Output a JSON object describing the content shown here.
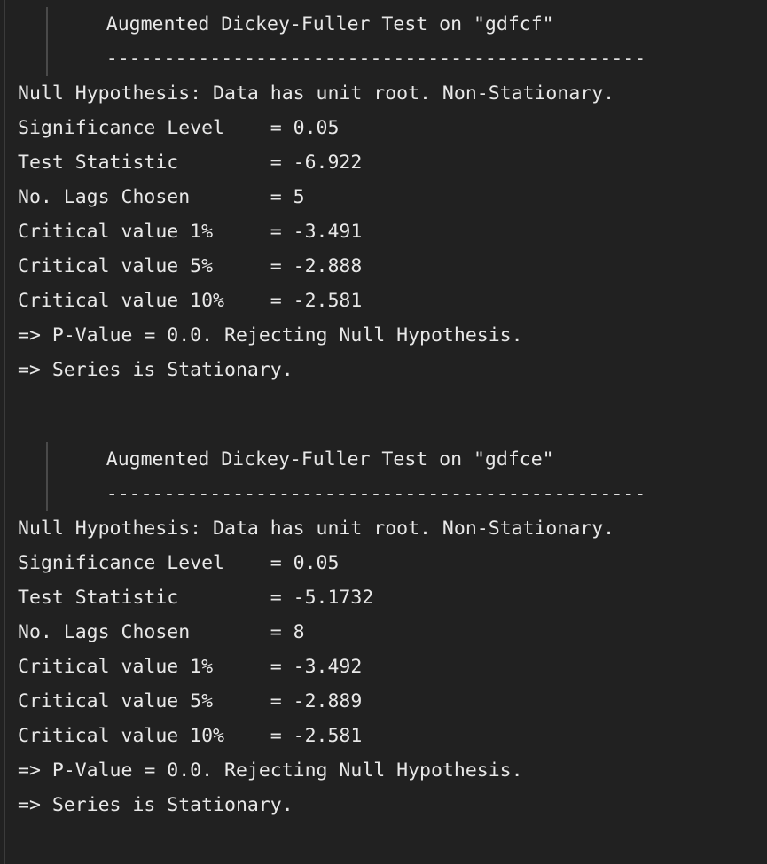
{
  "terminal": {
    "background_color": "#212121",
    "text_color": "#e8e8e8",
    "gutter_color": "#3b3b3b",
    "indent_guide_color": "#4a4a4a"
  },
  "blocks": [
    {
      "title": "    Augmented Dickey-Fuller Test on \"gdfcf\"",
      "divider": "    -----------------------------------------------",
      "null_hypothesis": "Null Hypothesis: Data has unit root. Non-Stationary.",
      "rows": [
        {
          "label": "Significance Level",
          "line": "Significance Level    = 0.05",
          "value": "0.05"
        },
        {
          "label": "Test Statistic",
          "line": "Test Statistic        = -6.922",
          "value": "-6.922"
        },
        {
          "label": "No. Lags Chosen",
          "line": "No. Lags Chosen       = 5",
          "value": "5"
        },
        {
          "label": "Critical value 1%",
          "line": "Critical value 1%     = -3.491",
          "value": "-3.491"
        },
        {
          "label": "Critical value 5%",
          "line": "Critical value 5%     = -2.888",
          "value": "-2.888"
        },
        {
          "label": "Critical value 10%",
          "line": "Critical value 10%    = -2.581",
          "value": "-2.581"
        }
      ],
      "pvalue_line": "=> P-Value = 0.0. Rejecting Null Hypothesis.",
      "conclusion_line": "=> Series is Stationary."
    },
    {
      "title": "    Augmented Dickey-Fuller Test on \"gdfce\"",
      "divider": "    -----------------------------------------------",
      "null_hypothesis": "Null Hypothesis: Data has unit root. Non-Stationary.",
      "rows": [
        {
          "label": "Significance Level",
          "line": "Significance Level    = 0.05",
          "value": "0.05"
        },
        {
          "label": "Test Statistic",
          "line": "Test Statistic        = -5.1732",
          "value": "-5.1732"
        },
        {
          "label": "No. Lags Chosen",
          "line": "No. Lags Chosen       = 8",
          "value": "8"
        },
        {
          "label": "Critical value 1%",
          "line": "Critical value 1%     = -3.492",
          "value": "-3.492"
        },
        {
          "label": "Critical value 5%",
          "line": "Critical value 5%     = -2.889",
          "value": "-2.889"
        },
        {
          "label": "Critical value 10%",
          "line": "Critical value 10%    = -2.581",
          "value": "-2.581"
        }
      ],
      "pvalue_line": "=> P-Value = 0.0. Rejecting Null Hypothesis.",
      "conclusion_line": "=> Series is Stationary."
    }
  ]
}
